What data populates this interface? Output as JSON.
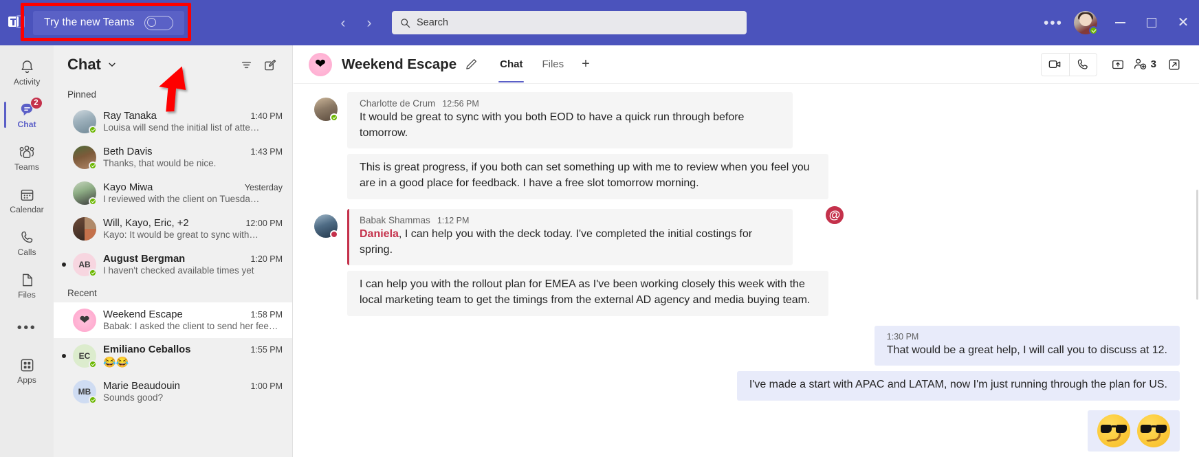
{
  "titlebar": {
    "app_logo": "teams-logo",
    "try_new_teams_label": "Try the new Teams",
    "toggle_state": "off",
    "back_glyph": "‹",
    "forward_glyph": "›",
    "search_placeholder": "Search",
    "more_glyph": "•••",
    "presence": "Available",
    "minimize_label": "",
    "maximize_label": "",
    "close_glyph": "✕",
    "bar_color": "#4b53bc"
  },
  "rail": {
    "items": [
      {
        "label": "Activity",
        "icon": "bell-icon",
        "active": false,
        "badge": ""
      },
      {
        "label": "Chat",
        "icon": "chat-icon",
        "active": true,
        "badge": "2"
      },
      {
        "label": "Teams",
        "icon": "teams-people-icon",
        "active": false,
        "badge": ""
      },
      {
        "label": "Calendar",
        "icon": "calendar-icon",
        "active": false,
        "badge": ""
      },
      {
        "label": "Calls",
        "icon": "phone-icon",
        "active": false,
        "badge": ""
      },
      {
        "label": "Files",
        "icon": "file-icon",
        "active": false,
        "badge": ""
      }
    ],
    "more_glyph": "•••",
    "apps_label": "Apps",
    "accent": "#5b5fc7",
    "badge_color": "#c4314b"
  },
  "chatlist": {
    "title": "Chat",
    "filter_icon": "filter-icon",
    "compose_icon": "compose-icon",
    "sections": [
      {
        "name": "Pinned",
        "rows": [
          {
            "name": "Ray Tanaka",
            "time": "1:40 PM",
            "preview": "Louisa will send the initial list of atte…",
            "unread": false,
            "bold": false,
            "avatar_kind": "photo",
            "avatar_hue": 30,
            "initials": "",
            "presence": "available"
          },
          {
            "name": "Beth Davis",
            "time": "1:43 PM",
            "preview": "Thanks, that would be nice.",
            "unread": false,
            "bold": false,
            "avatar_kind": "photo",
            "avatar_hue": 95,
            "initials": "",
            "presence": "available"
          },
          {
            "name": "Kayo Miwa",
            "time": "Yesterday",
            "preview": "I reviewed with the client on Tuesda…",
            "unread": false,
            "bold": false,
            "avatar_kind": "photo",
            "avatar_hue": 150,
            "initials": "",
            "presence": "available"
          },
          {
            "name": "Will, Kayo, Eric, +2",
            "time": "12:00 PM",
            "preview": "Kayo: It would be great to sync with…",
            "unread": false,
            "bold": false,
            "avatar_kind": "group",
            "avatar_hue": 20,
            "initials": "",
            "presence": "none"
          },
          {
            "name": "August Bergman",
            "time": "1:20 PM",
            "preview": "I haven't checked available times yet",
            "unread": true,
            "bold": true,
            "avatar_kind": "initials",
            "avatar_hue": 340,
            "initials": "AB",
            "presence": "available"
          }
        ]
      },
      {
        "name": "Recent",
        "rows": [
          {
            "name": "Weekend Escape",
            "time": "1:58 PM",
            "preview": "Babak: I asked the client to send her feed…",
            "unread": false,
            "bold": false,
            "avatar_kind": "heart",
            "avatar_hue": 335,
            "initials": "",
            "presence": "none",
            "selected": true
          },
          {
            "name": "Emiliano Ceballos",
            "time": "1:55 PM",
            "preview": "😂😂",
            "unread": true,
            "bold": true,
            "avatar_kind": "initials",
            "avatar_hue": 90,
            "initials": "EC",
            "presence": "available"
          },
          {
            "name": "Marie Beaudouin",
            "time": "1:00 PM",
            "preview": "Sounds good?",
            "unread": false,
            "bold": false,
            "avatar_kind": "initials",
            "avatar_hue": 215,
            "initials": "MB",
            "presence": "available"
          }
        ]
      }
    ]
  },
  "conversation": {
    "avatar_emoji": "❤",
    "title": "Weekend Escape",
    "edit_icon": "pencil-icon",
    "tabs": [
      {
        "label": "Chat",
        "active": true
      },
      {
        "label": "Files",
        "active": false
      }
    ],
    "add_tab_glyph": "+",
    "actions": {
      "video_icon": "video-call-icon",
      "audio_icon": "audio-call-icon",
      "share_icon": "share-screen-icon",
      "add_people_icon": "add-people-icon",
      "participant_count": "3",
      "popout_icon": "pop-out-icon"
    },
    "messages": [
      {
        "kind": "incoming",
        "author": "Charlotte de Crum",
        "time": "12:56 PM",
        "text": "It would be great to sync with you both EOD to have a quick run through before tomorrow.",
        "presence": "available",
        "avatar_hue": 28,
        "urgent": false,
        "mention": ""
      },
      {
        "kind": "incoming-cont",
        "author": "",
        "time": "",
        "text": "This is great progress, if you both can set something up with me to review when you feel you are in a good place for feedback. I have a free slot tomorrow morning.",
        "urgent": false,
        "mention": ""
      },
      {
        "kind": "incoming",
        "author": "Babak Shammas",
        "time": "1:12 PM",
        "mention": "Daniela",
        "text": ", I can help you with the deck today. I've completed the initial costings for spring.",
        "presence": "busy",
        "avatar_hue": 200,
        "urgent": true,
        "at_badge": "@"
      },
      {
        "kind": "incoming-cont",
        "author": "",
        "time": "",
        "text": "I can help you with the rollout plan for EMEA as I've been working closely this week with the local marketing team to get the timings from the external AD agency and media buying team.",
        "urgent": false,
        "mention": ""
      },
      {
        "kind": "outgoing",
        "time": "1:30 PM",
        "text": "That would be a great help, I will call you to discuss at 12."
      },
      {
        "kind": "outgoing-cont",
        "time": "",
        "text": "I've made a start with APAC and LATAM, now I'm just running through the plan for US."
      },
      {
        "kind": "outgoing-emoji",
        "emojis": [
          "😎",
          "😎"
        ]
      }
    ]
  },
  "annotations": {
    "highlight_box": "try-new-teams-highlight",
    "arrow": "pointer-arrow",
    "color": "#fe0000"
  }
}
